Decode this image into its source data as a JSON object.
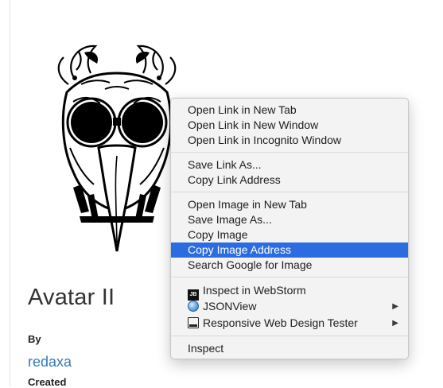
{
  "page": {
    "title": "Avatar II",
    "by_label": "By",
    "author": "redaxa",
    "created_label": "Created"
  },
  "context_menu": {
    "items": [
      {
        "label": "Open Link in New Tab"
      },
      {
        "label": "Open Link in New Window"
      },
      {
        "label": "Open Link in Incognito Window"
      },
      {
        "label": "Save Link As..."
      },
      {
        "label": "Copy Link Address"
      },
      {
        "label": "Open Image in New Tab"
      },
      {
        "label": "Save Image As..."
      },
      {
        "label": "Copy Image"
      },
      {
        "label": "Copy Image Address",
        "highlighted": true
      },
      {
        "label": "Search Google for Image"
      },
      {
        "label": "Inspect in WebStorm",
        "icon": "webstorm-icon"
      },
      {
        "label": "JSONView",
        "icon": "jsonview-icon",
        "submenu": true
      },
      {
        "label": "Responsive Web Design Tester",
        "icon": "responsive-tester-icon",
        "submenu": true
      },
      {
        "label": "Inspect"
      }
    ]
  },
  "icons": {
    "webstorm_badge": "JB"
  },
  "colors": {
    "highlight": "#2b6de1",
    "link": "#337ab7",
    "menu_background": "#f3f3f3"
  }
}
